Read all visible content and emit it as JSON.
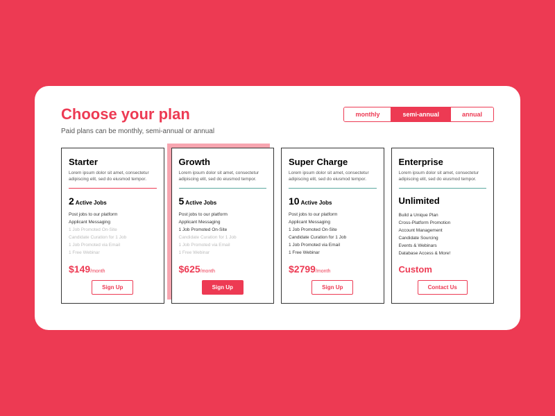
{
  "header": {
    "title": "Choose your plan",
    "subtitle": "Paid plans can be monthly, semi-annual or annual"
  },
  "toggle": {
    "options": [
      "monthly",
      "semi-annual",
      "annual"
    ],
    "active": 1
  },
  "plans": [
    {
      "name": "Starter",
      "desc": "Lorem ipsum dolor sit amet, consectetur adipiscing elit, sed do eiusmod tempor.",
      "jobs_num": "2",
      "jobs_label": "Active Jobs",
      "features": [
        {
          "text": "Post jobs to our platform",
          "muted": false
        },
        {
          "text": "Applicant Messaging",
          "muted": false
        },
        {
          "text": "1 Job Promoted On-Site",
          "muted": true
        },
        {
          "text": "Candidate Curation for 1 Job",
          "muted": true
        },
        {
          "text": "1 Job Promoted via Email",
          "muted": true
        },
        {
          "text": "1 Free Webinar",
          "muted": true
        }
      ],
      "price": "$149",
      "per": "/month",
      "cta": "Sign Up",
      "divider": "red",
      "featured": false,
      "filled": false
    },
    {
      "name": "Growth",
      "desc": "Lorem ipsum dolor sit amet, consectetur adipiscing elit, sed do eiusmod tempor.",
      "jobs_num": "5",
      "jobs_label": "Active Jobs",
      "features": [
        {
          "text": "Post jobs to our platform",
          "muted": false
        },
        {
          "text": "Applicant Messaging",
          "muted": false
        },
        {
          "text": "1 Job Promoted On-Site",
          "muted": false
        },
        {
          "text": "Candidate Curation for 1 Job",
          "muted": true
        },
        {
          "text": "1 Job Promoted via Email",
          "muted": true
        },
        {
          "text": "1 Free Webinar",
          "muted": true
        }
      ],
      "price": "$625",
      "per": "/month",
      "cta": "Sign Up",
      "divider": "teal",
      "featured": true,
      "filled": true
    },
    {
      "name": "Super Charge",
      "desc": "Lorem ipsum dolor sit amet, consectetur adipiscing elit, sed do eiusmod tempor.",
      "jobs_num": "10",
      "jobs_label": "Active Jobs",
      "features": [
        {
          "text": "Post jobs to our platform",
          "muted": false
        },
        {
          "text": "Applicant Messaging",
          "muted": false
        },
        {
          "text": "1 Job Promoted On-Site",
          "muted": false
        },
        {
          "text": "Candidate Curation for 1 Job",
          "muted": false
        },
        {
          "text": "1 Job Promoted via Email",
          "muted": false
        },
        {
          "text": "1 Free Webinar",
          "muted": false
        }
      ],
      "price": "$2799",
      "per": "/month",
      "cta": "Sign Up",
      "divider": "teal",
      "featured": false,
      "filled": false
    },
    {
      "name": "Enterprise",
      "desc": "Lorem ipsum dolor sit amet, consectetur adipiscing elit, sed do eiusmod tempor.",
      "unlimited": "Unlimited",
      "features": [
        {
          "text": "Build a Unique Plan",
          "muted": false
        },
        {
          "text": "Cross-Platform Promotion",
          "muted": false
        },
        {
          "text": "Account Management",
          "muted": false
        },
        {
          "text": "Candidate Sourcing",
          "muted": false
        },
        {
          "text": "Events & Webinars",
          "muted": false
        },
        {
          "text": "Database Access & More!",
          "muted": false
        }
      ],
      "price_custom": "Custom",
      "cta": "Contact Us",
      "divider": "teal",
      "featured": false,
      "filled": false
    }
  ]
}
